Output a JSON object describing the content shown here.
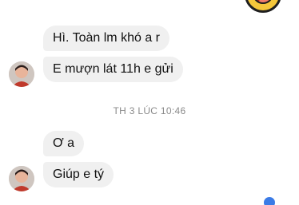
{
  "conversation": {
    "messages": [
      {
        "text": "Hì. Toàn lm khó a r"
      },
      {
        "text": "E mượn lát 11h e gửi"
      },
      {
        "text": "Ơ a"
      },
      {
        "text": "Giúp e tý"
      }
    ],
    "timestamp": "TH 3 LÚC 10:46"
  },
  "icons": {
    "sticker": "laughing-face-icon",
    "avatar": "user-avatar",
    "read_receipt": "seen-avatar-icon"
  }
}
